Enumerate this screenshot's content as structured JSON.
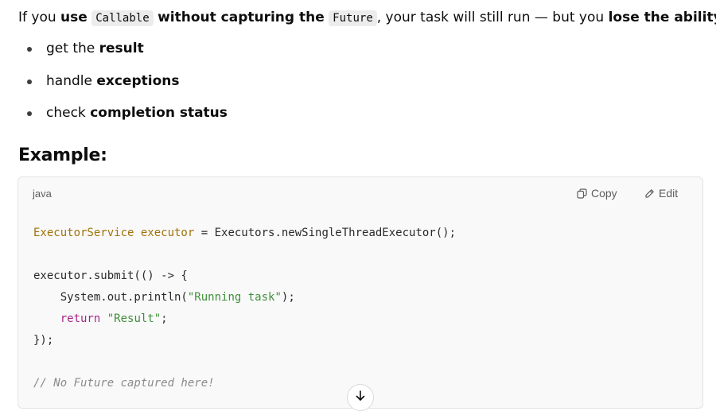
{
  "intro": {
    "part1": "If you ",
    "bold_use": "use",
    "code_callable": "Callable",
    "bold_without": "without capturing the",
    "code_future": "Future",
    "part2": ", your task will still run — but you ",
    "bold_lose": "lose the ability to",
    "part3": ":"
  },
  "points": [
    {
      "text": "get the ",
      "bold": "result"
    },
    {
      "text": "handle ",
      "bold": "exceptions"
    },
    {
      "text": "check ",
      "bold": "completion status"
    }
  ],
  "example_heading": "Example:",
  "code_block": {
    "language": "java",
    "copy_label": "Copy",
    "edit_label": "Edit",
    "copy_icon": "copy-icon",
    "edit_icon": "pencil-icon",
    "lines": {
      "l1_type": "ExecutorService executor",
      "l1_rest": " = Executors.newSingleThreadExecutor();",
      "l3": "executor.submit(() -> {",
      "l4_pre": "    System.out.println(",
      "l4_str": "\"Running task\"",
      "l4_post": ");",
      "l5_indent": "    ",
      "l5_kw": "return",
      "l5_space": " ",
      "l5_str": "\"Result\"",
      "l5_post": ";",
      "l6": "});",
      "l8_comment": "// No Future captured here!"
    }
  },
  "scroll_button_icon": "arrow-down-icon",
  "colors": {
    "type": "#a0720a",
    "string": "#3f8f3a",
    "keyword": "#a6268a",
    "comment": "#8a8a8a"
  }
}
